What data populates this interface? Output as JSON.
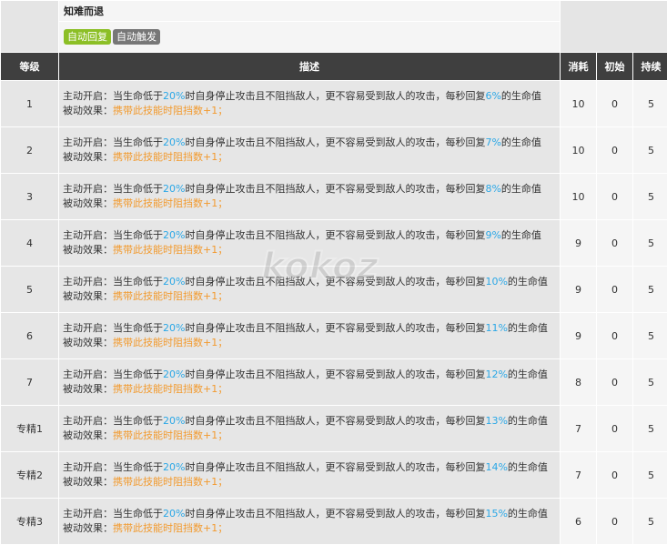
{
  "skill": {
    "name": "知难而退",
    "tags": [
      {
        "label": "自动回复",
        "color": "#8cbf26"
      },
      {
        "label": "自动触发",
        "color": "#777777"
      }
    ]
  },
  "headers": {
    "level": "等级",
    "desc": "描述",
    "cost": "消耗",
    "initial": "初始",
    "duration": "持续"
  },
  "desc_parts": {
    "active_prefix": "主动开启：当生命低于",
    "threshold": "20%",
    "active_mid": "时自身停止攻击且不阻挡敌人，更不容易受到敌人的攻击，每秒回复",
    "active_suffix": "的生命值",
    "passive_label": "被动效果：",
    "passive_text": "携带此技能时阻挡数+1；"
  },
  "rows": [
    {
      "level": "1",
      "heal": "6%",
      "cost": "10",
      "initial": "0",
      "duration": "5"
    },
    {
      "level": "2",
      "heal": "7%",
      "cost": "10",
      "initial": "0",
      "duration": "5"
    },
    {
      "level": "3",
      "heal": "8%",
      "cost": "10",
      "initial": "0",
      "duration": "5"
    },
    {
      "level": "4",
      "heal": "9%",
      "cost": "9",
      "initial": "0",
      "duration": "5"
    },
    {
      "level": "5",
      "heal": "10%",
      "cost": "9",
      "initial": "0",
      "duration": "5"
    },
    {
      "level": "6",
      "heal": "11%",
      "cost": "9",
      "initial": "0",
      "duration": "5"
    },
    {
      "level": "7",
      "heal": "12%",
      "cost": "8",
      "initial": "0",
      "duration": "5"
    },
    {
      "level": "专精1",
      "heal": "13%",
      "cost": "7",
      "initial": "0",
      "duration": "5"
    },
    {
      "level": "专精2",
      "heal": "14%",
      "cost": "7",
      "initial": "0",
      "duration": "5"
    },
    {
      "level": "专精3",
      "heal": "15%",
      "cost": "6",
      "initial": "0",
      "duration": "5"
    }
  ],
  "watermark": {
    "icon": "kokoz-logo-watermark",
    "text": "kokoz"
  },
  "colors": {
    "highlight_blue": "#2aa7e6",
    "highlight_orange": "#f29a2e",
    "header_bg": "#3f3f3f"
  }
}
